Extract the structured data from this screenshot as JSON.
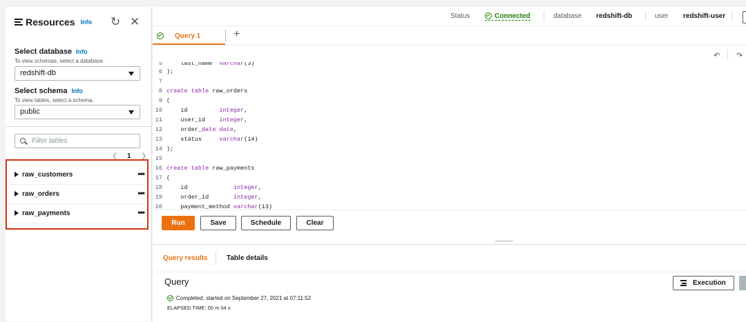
{
  "sidebar": {
    "title": "Resources",
    "title_info": "Info",
    "refresh_icon": "refresh-icon",
    "close_icon": "close-icon",
    "database_label": "Select database",
    "database_info": "Info",
    "database_hint": "To view schemas, select a database.",
    "database_value": "redshift-db",
    "schema_label": "Select schema",
    "schema_info": "Info",
    "schema_hint": "To view tables, select a schema.",
    "schema_value": "public",
    "filter_placeholder": "Filter tables",
    "page": "1",
    "tables": [
      {
        "name": "raw_customers",
        "actions": "•••"
      },
      {
        "name": "raw_orders",
        "actions": "•••"
      },
      {
        "name": "raw_payments",
        "actions": "•••"
      }
    ]
  },
  "header": {
    "status_label": "Status",
    "status_value": "Connected",
    "database_label": "database",
    "database_value": "redshift-db",
    "user_label": "user",
    "user_value": "redshift-user"
  },
  "tabs": {
    "query_tab": "Query 1",
    "add_tab": "+"
  },
  "editor": {
    "lines": [
      {
        "n": "5",
        "code": "    last_name  varchar(3)"
      },
      {
        "n": "6",
        "code": ");"
      },
      {
        "n": "7",
        "code": ""
      },
      {
        "n": "8",
        "code": "create table raw_orders"
      },
      {
        "n": "9",
        "code": "("
      },
      {
        "n": "10",
        "code": "    id         integer,"
      },
      {
        "n": "11",
        "code": "    user_id    integer,"
      },
      {
        "n": "12",
        "code": "    order_date date,"
      },
      {
        "n": "13",
        "code": "    status     varchar(14)"
      },
      {
        "n": "14",
        "code": ");"
      },
      {
        "n": "15",
        "code": ""
      },
      {
        "n": "16",
        "code": "create table raw_payments"
      },
      {
        "n": "17",
        "code": "("
      },
      {
        "n": "18",
        "code": "    id             integer,"
      },
      {
        "n": "19",
        "code": "    order_id       integer,"
      },
      {
        "n": "20",
        "code": "    payment_method varchar(13)"
      }
    ]
  },
  "toolbar": {
    "run": "Run",
    "save": "Save",
    "schedule": "Schedule",
    "clear": "Clear"
  },
  "results": {
    "tab_query_results": "Query results",
    "tab_table_details": "Table details",
    "heading": "Query",
    "status_text": "Completed, started on September 27, 2021 at 07:11:52",
    "elapsed": "ELAPSED TIME: 00 m 04 s",
    "execution_button": "Execution"
  },
  "colors": {
    "accent": "#ec7211",
    "link": "#0073bb",
    "success": "#1d8102",
    "highlight_border": "#d13212",
    "keyword": "#8e24aa"
  }
}
